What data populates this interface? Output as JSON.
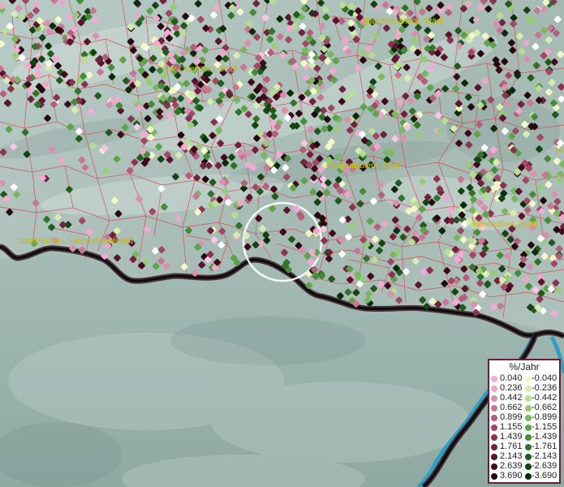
{
  "map": {
    "place_labels": [
      "Bad Kreuznach, Stadt",
      "Idar-Oberstein, Stadt",
      "Kaiserslautern, Stadt",
      "Edenkoben, Stadt",
      "Saarbrücken, Landeshauptstadt",
      "Ma"
    ],
    "dot_color_legend": [
      "#f4a9d6",
      "#eca8c9",
      "#d98fb0",
      "#c87696",
      "#b45f7c",
      "#a04866",
      "#8a3350",
      "#72223d",
      "#5a142b",
      "#410a1c",
      "#260810"
    ]
  },
  "legend": {
    "title": "%/Jahr",
    "positive": {
      "values": [
        "0.040",
        "0.236",
        "0.442",
        "0.662",
        "0.899",
        "1.155",
        "1.439",
        "1.761",
        "2.143",
        "2.639",
        "3.690"
      ],
      "colors": [
        "#f4a9d6",
        "#eca8c9",
        "#d98fb0",
        "#c87696",
        "#b45f7c",
        "#a04866",
        "#8a3350",
        "#72223d",
        "#5a142b",
        "#410a1c",
        "#260810"
      ]
    },
    "negative": {
      "values": [
        "-0.040",
        "-0.236",
        "-0.442",
        "-0.662",
        "-0.899",
        "-1.155",
        "-1.439",
        "-1.761",
        "-2.143",
        "-2.639",
        "-3.690"
      ],
      "colors": [
        "#f4f8c6",
        "#d6edb0",
        "#b7df94",
        "#96cc78",
        "#77b860",
        "#5ea34a",
        "#468b38",
        "#327229",
        "#225a1d",
        "#154414",
        "#0a2c0a"
      ]
    }
  }
}
